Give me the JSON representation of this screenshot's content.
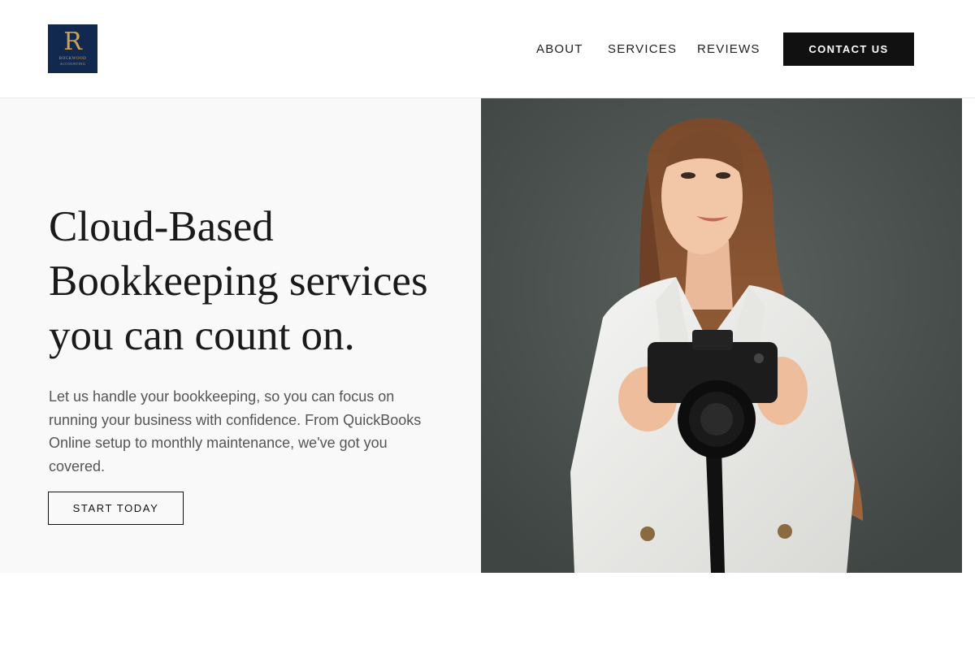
{
  "header": {
    "logo": {
      "letter": "R",
      "name": "ROCKWOOD",
      "sub": "ACCOUNTING",
      "background": "#12294f",
      "accent": "#c9a15a"
    },
    "nav": [
      {
        "label": "ABOUT"
      },
      {
        "label": "SERVICES"
      },
      {
        "label": "REVIEWS"
      }
    ],
    "contact_label": "CONTACT US"
  },
  "hero": {
    "title_lines": [
      "Cloud-Based",
      "Bookkeeping services",
      "you can count on."
    ],
    "description": "Let us handle your bookkeeping, so you can focus on running your business with confidence. From QuickBooks Online setup to monthly maintenance, we've got you covered.",
    "cta_label": "START TODAY",
    "image": {
      "subject": "woman-holding-camera-photo",
      "background": "#4a504d"
    }
  }
}
